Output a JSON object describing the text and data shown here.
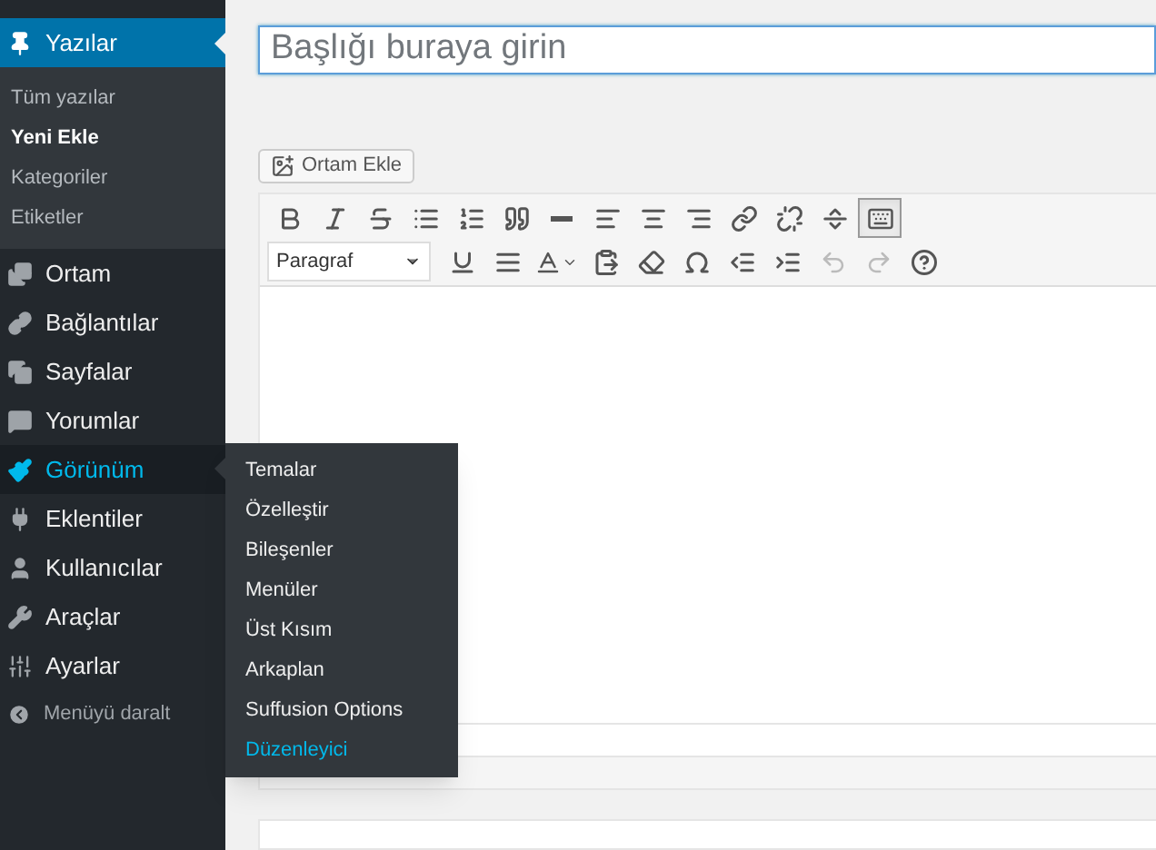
{
  "sidebar": {
    "items": [
      {
        "label": "Yazılar",
        "selected": true,
        "expanded": false,
        "children": [
          {
            "label": "Tüm yazılar",
            "selected": false
          },
          {
            "label": "Yeni Ekle",
            "selected": true
          },
          {
            "label": "Kategoriler",
            "selected": false
          },
          {
            "label": "Etiketler",
            "selected": false
          }
        ]
      },
      {
        "label": "Ortam",
        "selected": false,
        "expanded": false
      },
      {
        "label": "Bağlantılar",
        "selected": false,
        "expanded": false
      },
      {
        "label": "Sayfalar",
        "selected": false,
        "expanded": false
      },
      {
        "label": "Yorumlar",
        "selected": false,
        "expanded": false
      },
      {
        "label": "Görünüm",
        "selected": false,
        "expanded": true,
        "flyout": [
          {
            "label": "Temalar",
            "highlighted": false
          },
          {
            "label": "Özelleştir",
            "highlighted": false
          },
          {
            "label": "Bileşenler",
            "highlighted": false
          },
          {
            "label": "Menüler",
            "highlighted": false
          },
          {
            "label": "Üst Kısım",
            "highlighted": false
          },
          {
            "label": "Arkaplan",
            "highlighted": false
          },
          {
            "label": "Suffusion Options",
            "highlighted": false
          },
          {
            "label": "Düzenleyici",
            "highlighted": true
          }
        ]
      },
      {
        "label": "Eklentiler",
        "selected": false,
        "expanded": false
      },
      {
        "label": "Kullanıcılar",
        "selected": false,
        "expanded": false
      },
      {
        "label": "Araçlar",
        "selected": false,
        "expanded": false
      },
      {
        "label": "Ayarlar",
        "selected": false,
        "expanded": false
      }
    ],
    "collapse": {
      "label": "Menüyü daralt"
    }
  },
  "title_field": {
    "placeholder": "Başlığı buraya girin"
  },
  "media_button": {
    "label": "Ortam Ekle"
  },
  "editor": {
    "toolbar_toggle": {
      "pressed": true
    },
    "format_select": {
      "value": "Paragraf"
    },
    "undo": {
      "disabled": true
    },
    "redo": {
      "disabled": true
    }
  }
}
